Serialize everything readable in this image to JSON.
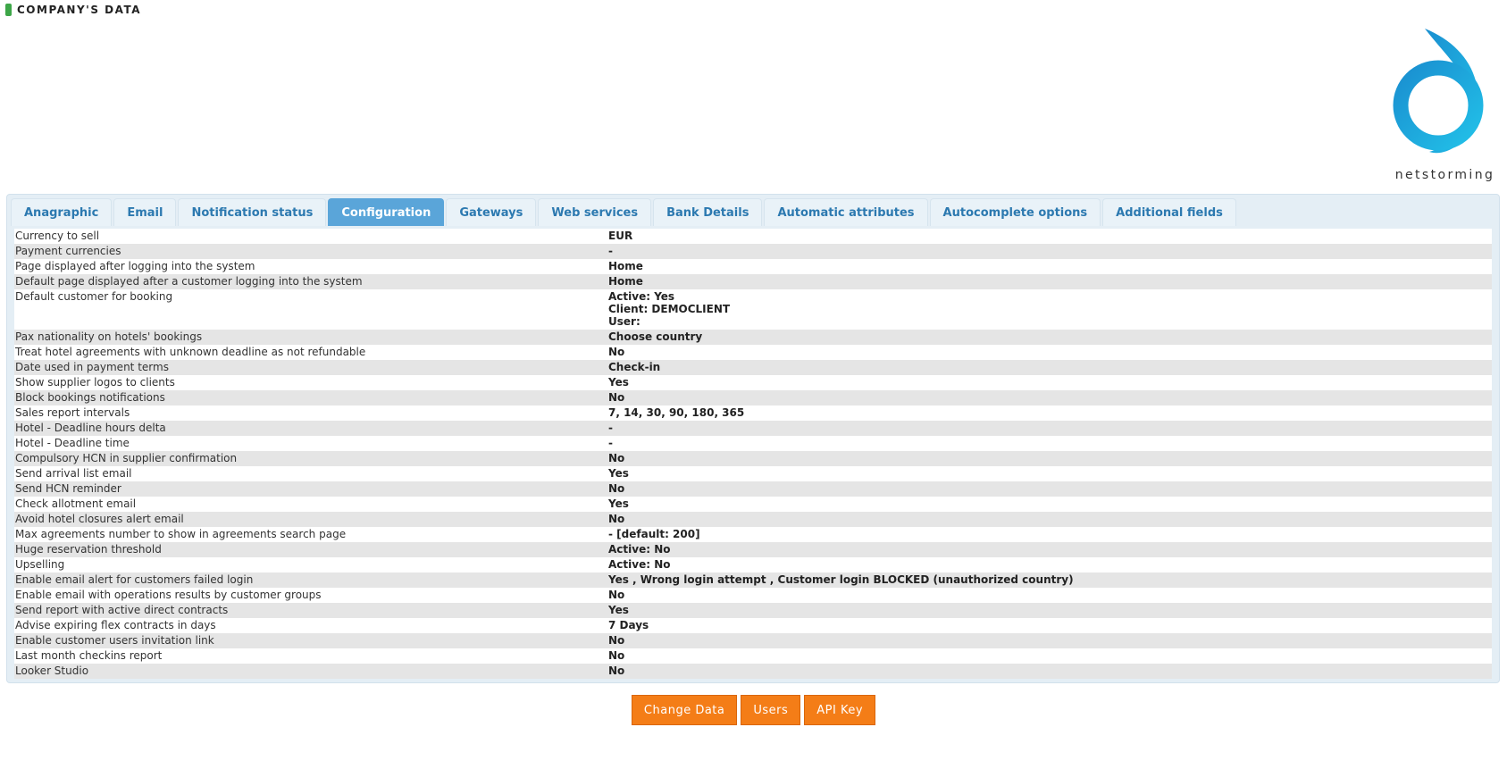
{
  "header": {
    "title": "COMPANY'S DATA"
  },
  "logo": {
    "text": "netstorming",
    "color": "#1aa3d9"
  },
  "tabs": [
    {
      "label": "Anagraphic",
      "active": false
    },
    {
      "label": "Email",
      "active": false
    },
    {
      "label": "Notification status",
      "active": false
    },
    {
      "label": "Configuration",
      "active": true
    },
    {
      "label": "Gateways",
      "active": false
    },
    {
      "label": "Web services",
      "active": false
    },
    {
      "label": "Bank Details",
      "active": false
    },
    {
      "label": "Automatic attributes",
      "active": false
    },
    {
      "label": "Autocomplete options",
      "active": false
    },
    {
      "label": "Additional fields",
      "active": false
    }
  ],
  "config_rows": [
    {
      "label": "Currency to sell",
      "value": "EUR"
    },
    {
      "label": "Payment currencies",
      "value": "-"
    },
    {
      "label": "Page displayed after logging into the system",
      "value": "Home"
    },
    {
      "label": "Default page displayed after a customer logging into the system",
      "value": "Home"
    },
    {
      "label": "Default customer for booking",
      "value": "Active: Yes\nClient: DEMOCLIENT\nUser:"
    },
    {
      "label": "Pax nationality on hotels' bookings",
      "value": "Choose country"
    },
    {
      "label": "Treat hotel agreements with unknown deadline as not refundable",
      "value": "No"
    },
    {
      "label": "Date used in payment terms",
      "value": "Check-in"
    },
    {
      "label": "Show supplier logos to clients",
      "value": "Yes"
    },
    {
      "label": "Block bookings notifications",
      "value": "No"
    },
    {
      "label": "Sales report intervals",
      "value": "7, 14, 30, 90, 180, 365"
    },
    {
      "label": "Hotel - Deadline hours delta",
      "value": "-"
    },
    {
      "label": "Hotel - Deadline time",
      "value": "-"
    },
    {
      "label": "Compulsory HCN in supplier confirmation",
      "value": "No"
    },
    {
      "label": "Send arrival list email",
      "value": "Yes"
    },
    {
      "label": "Send HCN reminder",
      "value": "No"
    },
    {
      "label": "Check allotment email",
      "value": "Yes"
    },
    {
      "label": "Avoid hotel closures alert email",
      "value": "No"
    },
    {
      "label": "Max agreements number to show in agreements search page",
      "value": "- [default: 200]"
    },
    {
      "label": "Huge reservation threshold",
      "value": "Active: No"
    },
    {
      "label": "Upselling",
      "value": "Active: No"
    },
    {
      "label": "Enable email alert for customers failed login",
      "value": "Yes , Wrong login attempt , Customer login BLOCKED (unauthorized country)"
    },
    {
      "label": "Enable email with operations results by customer groups",
      "value": "No"
    },
    {
      "label": "Send report with active direct contracts",
      "value": "Yes"
    },
    {
      "label": "Advise expiring flex contracts in days",
      "value": "7 Days"
    },
    {
      "label": "Enable customer users invitation link",
      "value": "No"
    },
    {
      "label": "Last month checkins report",
      "value": "No"
    },
    {
      "label": "Looker Studio",
      "value": "No"
    }
  ],
  "actions": {
    "change_data": "Change Data",
    "users": "Users",
    "api_key": "API Key"
  }
}
